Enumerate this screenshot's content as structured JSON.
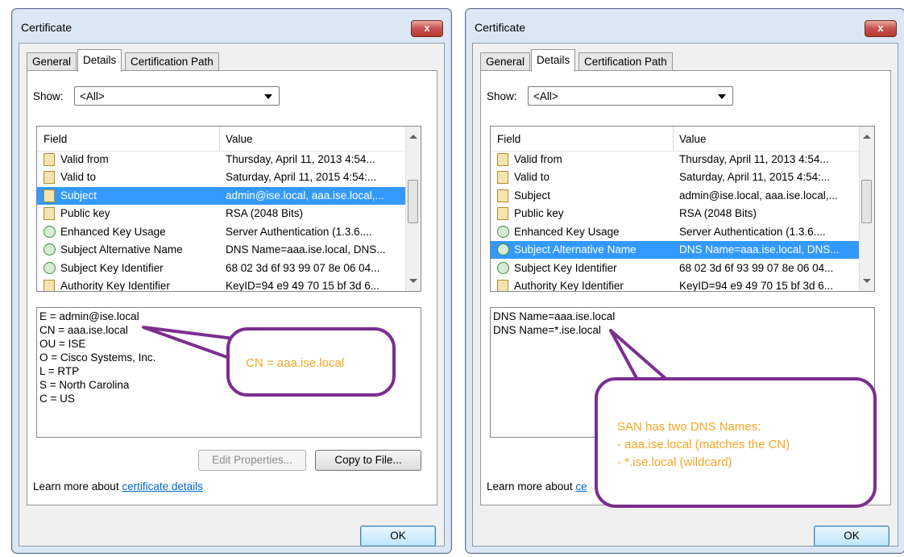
{
  "left": {
    "title": "Certificate",
    "close": "x",
    "tabs": [
      "General",
      "Details",
      "Certification Path"
    ],
    "show_label": "Show:",
    "show_value": "<All>",
    "columns": {
      "field": "Field",
      "value": "Value"
    },
    "rows": [
      {
        "field": "Valid from",
        "value": "Thursday, April 11, 2013 4:54..."
      },
      {
        "field": "Valid to",
        "value": "Saturday, April 11, 2015 4:54:..."
      },
      {
        "field": "Subject",
        "value": "admin@ise.local, aaa.ise.local,..."
      },
      {
        "field": "Public key",
        "value": "RSA (2048 Bits)"
      },
      {
        "field": "Enhanced Key Usage",
        "value": "Server Authentication (1.3.6...."
      },
      {
        "field": "Subject Alternative Name",
        "value": "DNS Name=aaa.ise.local, DNS..."
      },
      {
        "field": "Subject Key Identifier",
        "value": "68 02 3d 6f 93 99 07 8e 06 04..."
      },
      {
        "field": "Authority Key Identifier",
        "value": "KeyID=94 e9 49 70 15 bf 3d 6..."
      }
    ],
    "selected_row": "Subject",
    "value_lines": [
      "E = admin@ise.local",
      "CN = aaa.ise.local",
      "OU = ISE",
      "O = Cisco Systems, Inc.",
      "L = RTP",
      "S = North Carolina",
      "C = US"
    ],
    "edit_button": "Edit Properties...",
    "copy_button": "Copy to File...",
    "learn_prefix": "Learn more about ",
    "learn_link": "certificate details",
    "ok": "OK",
    "callout": "CN = aaa.ise.local"
  },
  "right": {
    "title": "Certificate",
    "close": "x",
    "tabs": [
      "General",
      "Details",
      "Certification Path"
    ],
    "show_label": "Show:",
    "show_value": "<All>",
    "columns": {
      "field": "Field",
      "value": "Value"
    },
    "rows": [
      {
        "field": "Valid from",
        "value": "Thursday, April 11, 2013 4:54..."
      },
      {
        "field": "Valid to",
        "value": "Saturday, April 11, 2015 4:54:..."
      },
      {
        "field": "Subject",
        "value": "admin@ise.local, aaa.ise.local,..."
      },
      {
        "field": "Public key",
        "value": "RSA (2048 Bits)"
      },
      {
        "field": "Enhanced Key Usage",
        "value": "Server Authentication (1.3.6...."
      },
      {
        "field": "Subject Alternative Name",
        "value": "DNS Name=aaa.ise.local, DNS..."
      },
      {
        "field": "Subject Key Identifier",
        "value": "68 02 3d 6f 93 99 07 8e 06 04..."
      },
      {
        "field": "Authority Key Identifier",
        "value": "KeyID=94 e9 49 70 15 bf 3d 6..."
      }
    ],
    "selected_row": "Subject Alternative Name",
    "value_lines": [
      "DNS Name=aaa.ise.local",
      "DNS Name=*.ise.local"
    ],
    "learn_prefix": "Learn more about ",
    "learn_link": "ce",
    "ok": "OK",
    "callout": [
      "SAN has two DNS Names:",
      "- aaa.ise.local (matches the CN)",
      "- *.ise.local (wildcard)"
    ]
  },
  "colors": {
    "selection": "#3399ff",
    "callout_border": "#7a2f8f",
    "callout_text": "#f5a623",
    "link": "#0066cc"
  }
}
